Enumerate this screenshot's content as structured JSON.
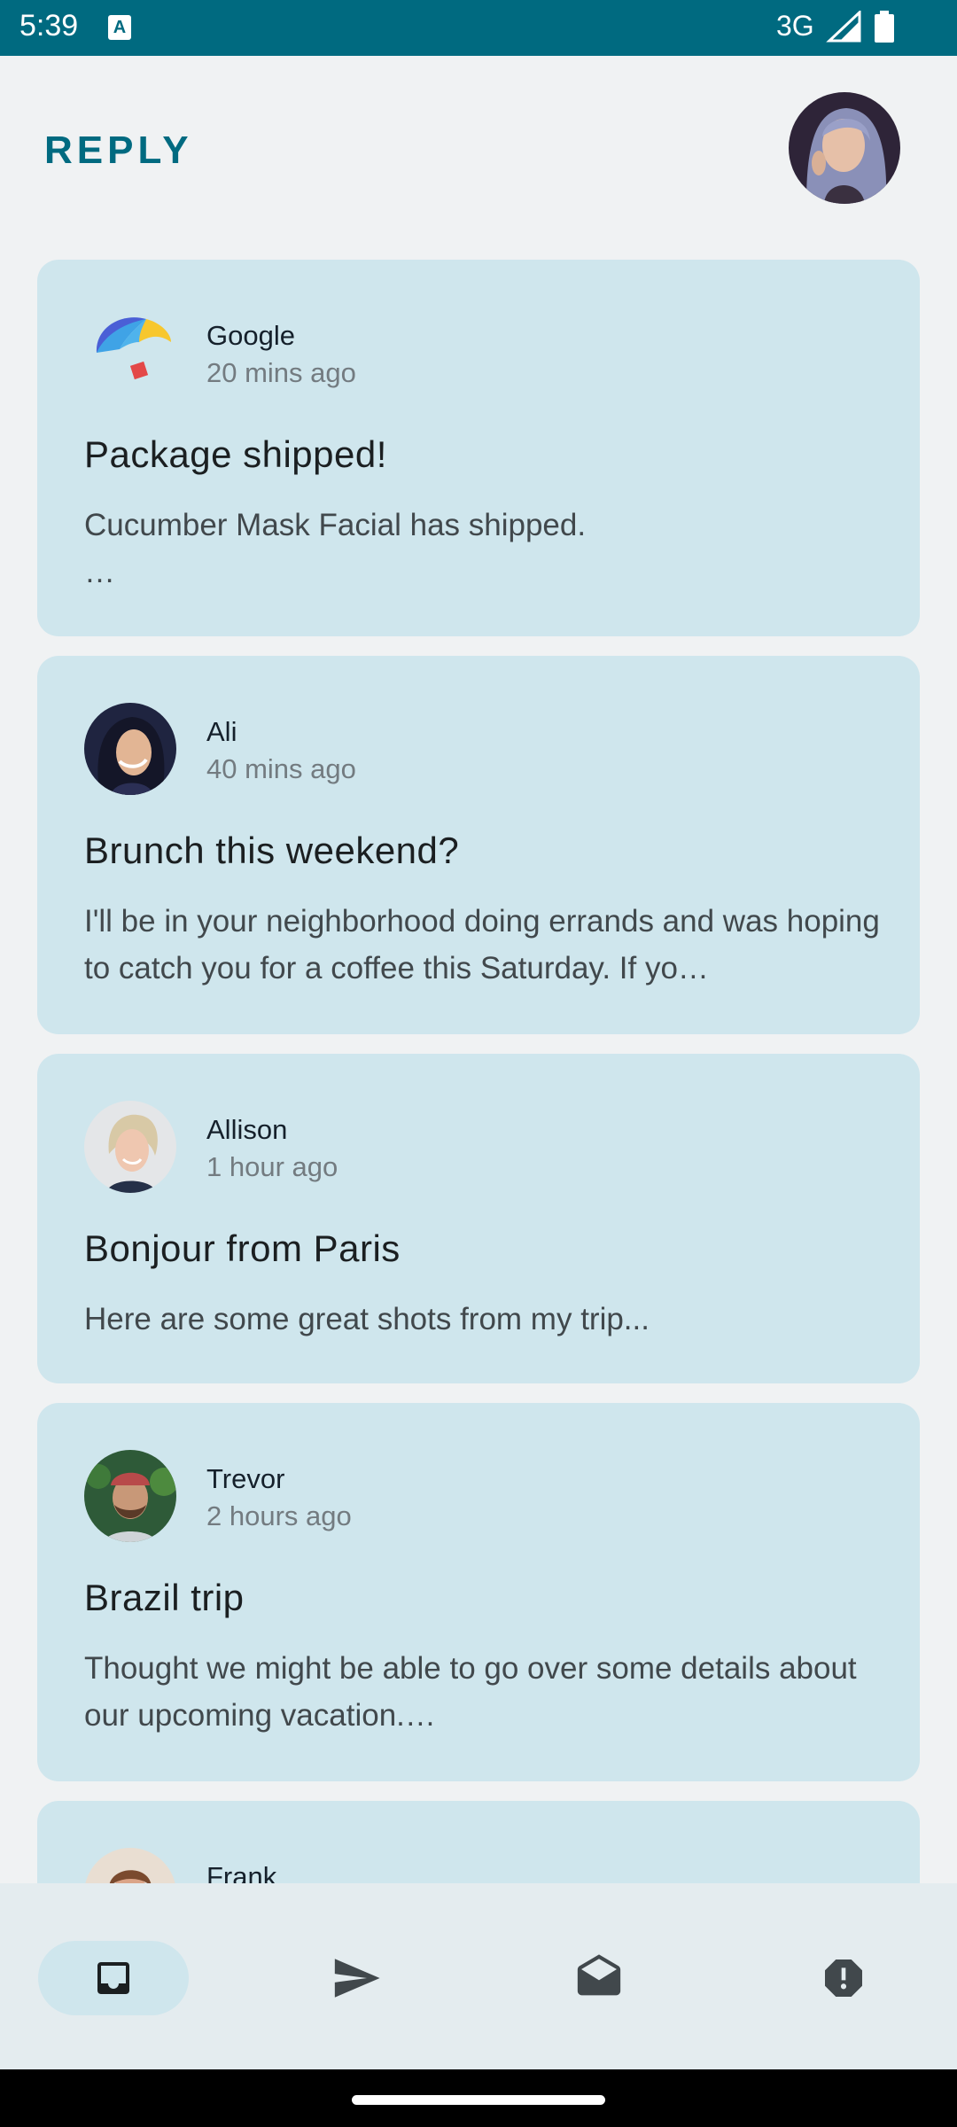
{
  "status_bar": {
    "time": "5:39",
    "notification_icon": "A",
    "network": "3G",
    "background_color": "#006a80"
  },
  "header": {
    "title": "REPLY",
    "profile_avatar": "user-avatar-icon"
  },
  "emails": [
    {
      "sender": "Google",
      "time": "20 mins ago",
      "subject": "Package shipped!",
      "preview": "Cucumber Mask Facial has shipped.\n…",
      "avatar": "google-umbrella-logo"
    },
    {
      "sender": "Ali",
      "time": "40 mins ago",
      "subject": "Brunch this weekend?",
      "preview": "I'll be in your neighborhood doing errands and was hoping to catch you for a coffee this Saturday. If yo…",
      "avatar": "ali-avatar"
    },
    {
      "sender": "Allison",
      "time": "1 hour ago",
      "subject": "Bonjour from Paris",
      "preview": "Here are some great shots from my trip...",
      "avatar": "allison-avatar"
    },
    {
      "sender": "Trevor",
      "time": "2 hours ago",
      "subject": "Brazil trip",
      "preview": "Thought we might be able to go over some details about our upcoming vacation.…",
      "avatar": "trevor-avatar"
    },
    {
      "sender": "Frank",
      "time": "",
      "subject": "",
      "preview": "",
      "avatar": "frank-avatar"
    }
  ],
  "bottom_nav": {
    "items": [
      {
        "icon": "inbox-icon",
        "active": true
      },
      {
        "icon": "send-icon",
        "active": false
      },
      {
        "icon": "drafts-icon",
        "active": false
      },
      {
        "icon": "report-icon",
        "active": false
      }
    ]
  },
  "colors": {
    "accent": "#006a80",
    "card": "#cfe6ed",
    "background": "#f0f2f3",
    "nav_background": "#e4ecef"
  }
}
